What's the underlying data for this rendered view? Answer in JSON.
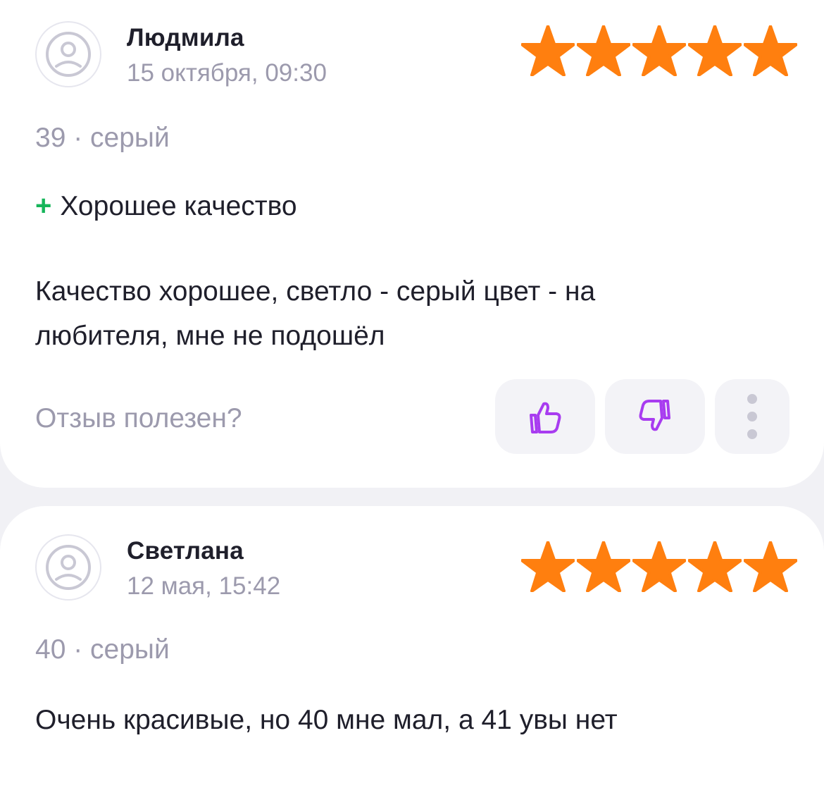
{
  "reviews": [
    {
      "author": "Людмила",
      "date": "15 октября, 09:30",
      "rating": 5,
      "variant": "39 · серый",
      "pros_sign": "+",
      "pros": "Хорошее качество",
      "text_line1": "Качество хорошее, светло - серый цвет - на",
      "text_line2": "любителя, мне не подошёл",
      "helpful_question": "Отзыв полезен?"
    },
    {
      "author": "Светлана",
      "date": "12 мая, 15:42",
      "rating": 5,
      "variant": "40 · серый",
      "text_line1": "Очень красивые, но 40 мне мал, а 41 увы нет"
    }
  ],
  "colors": {
    "star": "#ff7f0f",
    "accent": "#a83cf0",
    "pros_plus": "#16b55a",
    "muted_text": "#9c9aad"
  },
  "icons": {
    "avatar": "sad-face-icon",
    "like": "thumbs-up-icon",
    "dislike": "thumbs-down-icon",
    "more": "more-vertical-icon"
  }
}
